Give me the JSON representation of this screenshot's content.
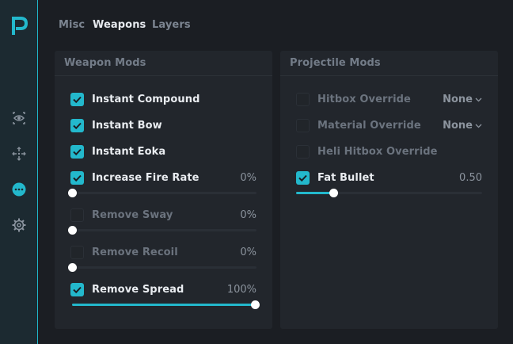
{
  "sidebar": {
    "logo_icon": "p-logo-icon",
    "items": [
      {
        "icon": "eye-icon",
        "active": false
      },
      {
        "icon": "crosshair-icon",
        "active": false
      },
      {
        "icon": "more-dots-icon",
        "active": true
      },
      {
        "icon": "gear-icon",
        "active": false
      }
    ]
  },
  "tabs": [
    "Misc",
    "Weapons",
    "Layers"
  ],
  "active_tab": "Weapons",
  "weapon_mods": {
    "title": "Weapon Mods",
    "instant_compound": {
      "label": "Instant Compound",
      "checked": true
    },
    "instant_bow": {
      "label": "Instant Bow",
      "checked": true
    },
    "instant_eoka": {
      "label": "Instant Eoka",
      "checked": true
    },
    "increase_fire_rate": {
      "label": "Increase Fire Rate",
      "checked": true,
      "value": "0%",
      "level": 0
    },
    "remove_sway": {
      "label": "Remove Sway",
      "checked": false,
      "value": "0%",
      "level": 0
    },
    "remove_recoil": {
      "label": "Remove Recoil",
      "checked": false,
      "value": "0%",
      "level": 0
    },
    "remove_spread": {
      "label": "Remove Spread",
      "checked": true,
      "value": "100%",
      "level": 1.0
    }
  },
  "projectile_mods": {
    "title": "Projectile Mods",
    "hitbox_override": {
      "label": "Hitbox Override",
      "checked": false,
      "selected": "None"
    },
    "material_override": {
      "label": "Material Override",
      "checked": false,
      "selected": "None"
    },
    "heli_hitbox_override": {
      "label": "Heli Hitbox Override",
      "checked": false
    },
    "fat_bullet": {
      "label": "Fat Bullet",
      "checked": true,
      "value": "0.50",
      "level": 0.2
    }
  },
  "colors": {
    "accent": "#23b8cc",
    "background": "#1b1e23",
    "panel": "#22262c",
    "sidebar": "#1c2a31"
  }
}
